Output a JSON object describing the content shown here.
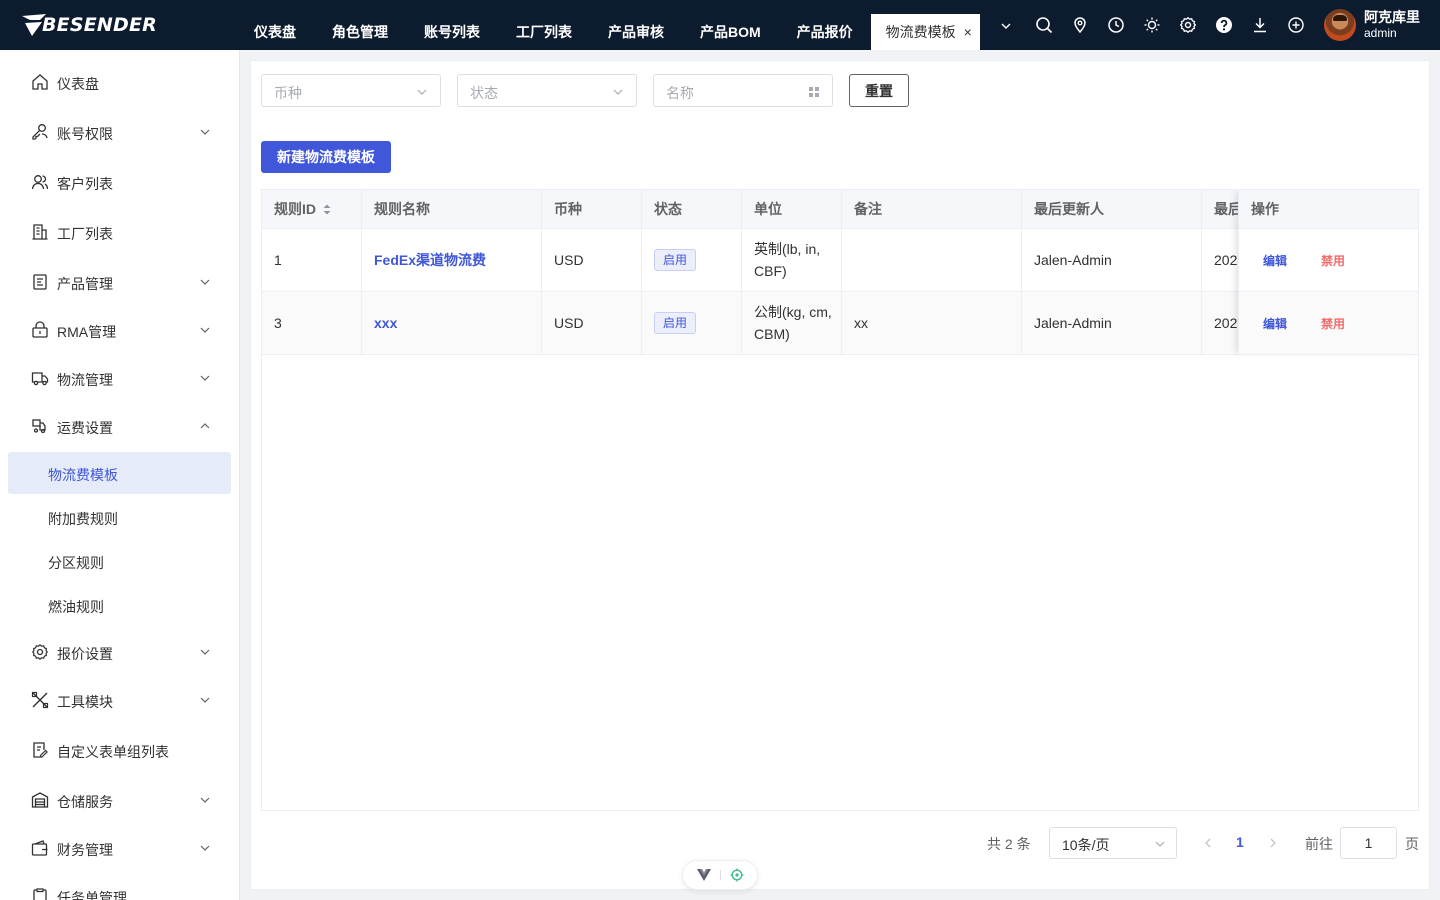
{
  "app": {
    "logo_text": "BESENDER"
  },
  "top_nav": {
    "tabs": [
      {
        "label": "仪表盘"
      },
      {
        "label": "角色管理"
      },
      {
        "label": "账号列表"
      },
      {
        "label": "工厂列表"
      },
      {
        "label": "产品审核"
      },
      {
        "label": "产品BOM"
      },
      {
        "label": "产品报价"
      },
      {
        "label": "物流费模板"
      }
    ],
    "active_tab": "物流费模板",
    "close_glyph": "×",
    "icons": [
      "search-icon",
      "location-icon",
      "clock-icon",
      "sun-icon",
      "gear-icon",
      "help-icon",
      "download-icon",
      "plus-circle-icon"
    ]
  },
  "user": {
    "name": "阿克库里",
    "role": "admin"
  },
  "sidebar": {
    "items": [
      {
        "label": "仪表盘",
        "icon": "home-icon"
      },
      {
        "label": "账号权限",
        "icon": "key-user-icon"
      },
      {
        "label": "客户列表",
        "icon": "users-icon"
      },
      {
        "label": "工厂列表",
        "icon": "building-icon"
      },
      {
        "label": "产品管理",
        "icon": "product-icon"
      },
      {
        "label": "RMA管理",
        "icon": "lock-box-icon"
      },
      {
        "label": "物流管理",
        "icon": "truck-icon"
      },
      {
        "label": "运费设置",
        "icon": "freight-icon"
      },
      {
        "label": "报价设置",
        "icon": "gear-icon"
      },
      {
        "label": "工具模块",
        "icon": "tools-icon"
      },
      {
        "label": "自定义表单组列表",
        "icon": "form-icon"
      },
      {
        "label": "仓储服务",
        "icon": "warehouse-icon"
      },
      {
        "label": "财务管理",
        "icon": "wallet-icon"
      },
      {
        "label": "任务单管理",
        "icon": "task-icon"
      }
    ],
    "sub_items": [
      {
        "label": "物流费模板"
      },
      {
        "label": "附加费规则"
      },
      {
        "label": "分区规则"
      },
      {
        "label": "燃油规则"
      }
    ]
  },
  "filters": {
    "currency_placeholder": "币种",
    "status_placeholder": "状态",
    "name_placeholder": "名称",
    "reset_label": "重置"
  },
  "create_button": "新建物流费模板",
  "table": {
    "columns": [
      "规则ID",
      "规则名称",
      "币种",
      "状态",
      "单位",
      "备注",
      "最后更新人",
      "最后",
      "操作"
    ],
    "rows": [
      {
        "id": "1",
        "name": "FedEx渠道物流费",
        "currency": "USD",
        "status": "启用",
        "unit": "英制(lb, in, CBF)",
        "remark": "",
        "updater": "Jalen-Admin",
        "updated": "202",
        "edit": "编辑",
        "disable": "禁用"
      },
      {
        "id": "3",
        "name": "xxx",
        "currency": "USD",
        "status": "启用",
        "unit": "公制(kg, cm, CBM)",
        "remark": "xx",
        "updater": "Jalen-Admin",
        "updated": "202",
        "edit": "编辑",
        "disable": "禁用"
      }
    ]
  },
  "pagination": {
    "total_text": "共 2 条",
    "page_size": "10条/页",
    "current_page": "1",
    "goto_label": "前往",
    "goto_value": "1",
    "page_suffix": "页"
  },
  "colors": {
    "topbar": "#0d1b2e",
    "accent": "#3f57d8",
    "danger": "#f56c6c",
    "active_bg": "#e6ebfa"
  }
}
